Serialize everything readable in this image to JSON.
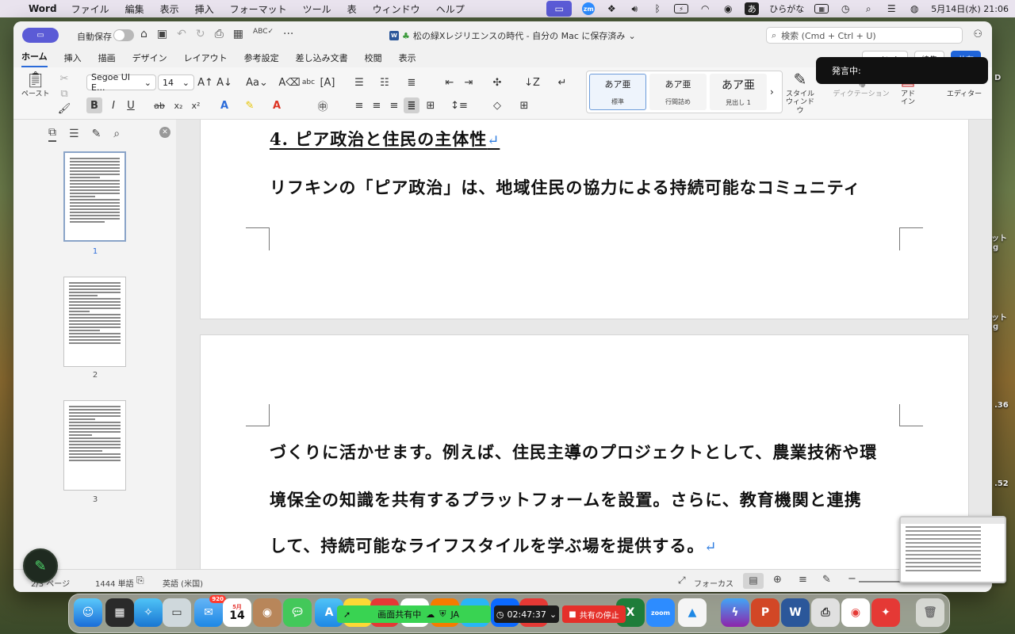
{
  "menubar": {
    "app_name": "Word",
    "menus": [
      "ファイル",
      "編集",
      "表示",
      "挿入",
      "フォーマット",
      "ツール",
      "表",
      "ウィンドウ",
      "ヘルプ"
    ],
    "ime_char": "あ",
    "ime_label": "ひらがな",
    "datetime": "5月14日(水) 21:06",
    "zoom_label": "zm"
  },
  "titlebar": {
    "autosave_label": "自動保存",
    "doc_title": "松の緑Xレジリエンスの時代 - 自分の Mac に保存済み",
    "search_placeholder": "検索 (Cmd + Ctrl + U)"
  },
  "ribbon_tabs": [
    "ホーム",
    "挿入",
    "描画",
    "デザイン",
    "レイアウト",
    "参考設定",
    "差し込み文書",
    "校閲",
    "表示"
  ],
  "ribbon_right": {
    "comment": "コメント",
    "edit": "編集",
    "share": "共有"
  },
  "ribbon": {
    "paste_label": "ペースト",
    "font_name": "Segoe UI E...",
    "font_size": "14",
    "styles": [
      {
        "sample": "あア亜",
        "name": "標準"
      },
      {
        "sample": "あア亜",
        "name": "行間詰め"
      },
      {
        "sample": "あア亜",
        "name": "見出し 1"
      }
    ],
    "style_window": "スタイル\nウィンドウ",
    "dictation": "ディクテーション",
    "addins": "アド\nイン",
    "editor": "エディター"
  },
  "speaking_toast": "発言中:",
  "nav": {
    "pages": [
      "1",
      "2",
      "3"
    ]
  },
  "document": {
    "heading": "4.  ピア政治と住民の主体性",
    "line1": "リフキンの「ピア政治」は、地域住民の協力による持続可能なコミュニティ",
    "line2": "づくりに活かせます。例えば、住民主導のプロジェクトとして、農業技術や環",
    "line3": "境保全の知識を共有するプラットフォームを設置。さらに、教育機関と連携",
    "line4": "して、持続可能なライフスタイルを学ぶ場を提供する。"
  },
  "statusbar": {
    "page": "2/3 ページ",
    "words": "1444 単語",
    "language": "英語 (米国)",
    "focus": "フォーカス"
  },
  "share_bar": {
    "sharing": "画面共有中",
    "lang": "JA",
    "timer": "02:47:37",
    "stop": "共有の停止"
  },
  "dock": {
    "mail_badge": "920",
    "cal_month": "5月",
    "cal_day": "14",
    "zoom_label": "zoom"
  },
  "desktop_fragments": [
    "D",
    "ット",
    "g",
    "ット",
    "g",
    ".36",
    ".52"
  ]
}
